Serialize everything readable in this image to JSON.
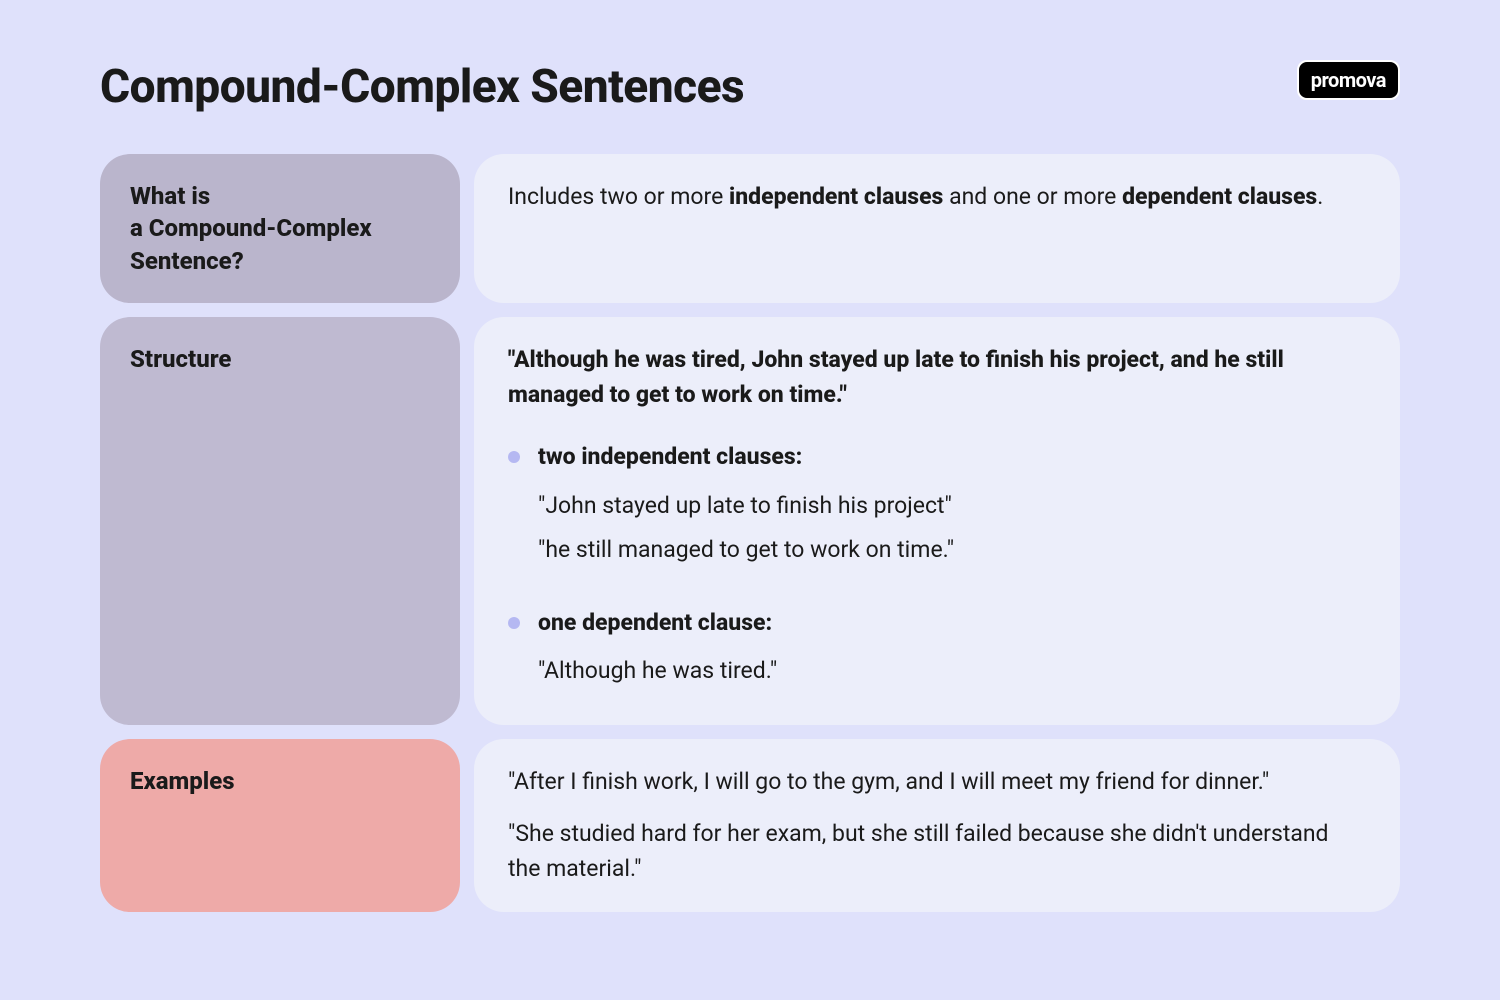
{
  "title": "Compound-Complex Sentences",
  "brand": "promova",
  "sections": {
    "definition": {
      "heading_line1": "What is",
      "heading_line2": "a Compound-Complex",
      "heading_line3": "Sentence?",
      "body_pre": "Includes two or more ",
      "body_bold1": "independent clauses",
      "body_mid": " and one or more ",
      "body_bold2": "dependent clauses",
      "body_post": "."
    },
    "structure": {
      "heading": "Structure",
      "quote": "\"Although he was tired, John stayed up late to finish his project, and he still managed to get to work on time.\"",
      "group1_label": "two independent clauses:",
      "group1_items": [
        "\"John stayed up late to finish his project\"",
        "\"he still managed to get to work on time.\""
      ],
      "group2_label": "one dependent clause:",
      "group2_items": [
        "\"Although he was tired.\""
      ]
    },
    "examples": {
      "heading": "Examples",
      "items": [
        "\"After I finish work, I will go to the gym, and I will meet my friend for dinner.\"",
        "\"She studied hard for her exam, but she still failed because she didn't understand the material.\""
      ]
    }
  }
}
